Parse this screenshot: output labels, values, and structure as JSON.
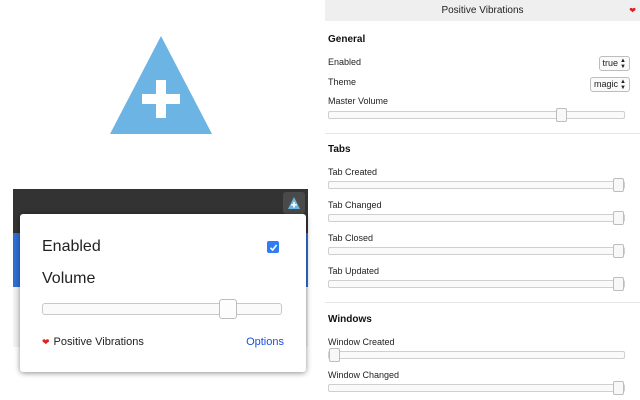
{
  "popup": {
    "enabled_label": "Enabled",
    "enabled_checked": true,
    "volume_label": "Volume",
    "volume_level": 0.8,
    "brand_label": "Positive Vibrations",
    "options_link": "Options"
  },
  "options": {
    "header_title": "Positive Vibrations",
    "sections": {
      "general": {
        "title": "General",
        "enabled_label": "Enabled",
        "enabled_value": "true",
        "theme_label": "Theme",
        "theme_value": "magic",
        "master_volume_label": "Master Volume",
        "master_volume_level": 0.8
      },
      "tabs": {
        "title": "Tabs",
        "created_label": "Tab Created",
        "created_level": 1.0,
        "changed_label": "Tab Changed",
        "changed_level": 1.0,
        "closed_label": "Tab Closed",
        "closed_level": 1.0,
        "updated_label": "Tab Updated",
        "updated_level": 1.0
      },
      "windows": {
        "title": "Windows",
        "created_label": "Window Created",
        "created_level": 0.0,
        "changed_label": "Window Changed",
        "changed_level": 1.0
      }
    }
  },
  "colors": {
    "logo_blue": "#6cb4e4",
    "accent_blue": "#2f6fd6",
    "heart_red": "#e02020"
  }
}
